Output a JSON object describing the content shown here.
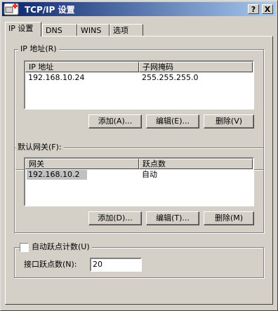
{
  "window": {
    "title": "TCP/IP 设置",
    "help_label": "?",
    "close_label": "X"
  },
  "tabs": [
    {
      "label": "IP 设置",
      "active": true
    },
    {
      "label": "DNS"
    },
    {
      "label": "WINS"
    },
    {
      "label": "选项"
    }
  ],
  "ip_group": {
    "label": "IP 地址(R)",
    "columns": [
      "IP 地址",
      "子网掩码"
    ],
    "rows": [
      [
        "192.168.10.24",
        "255.255.255.0"
      ]
    ],
    "buttons": {
      "add": "添加(A)...",
      "edit": "编辑(E)...",
      "delete": "删除(V)"
    }
  },
  "gateway_group": {
    "label": "默认网关(F):",
    "columns": [
      "网关",
      "跃点数"
    ],
    "rows": [
      [
        "192.168.10.2",
        "自动"
      ]
    ],
    "buttons": {
      "add": "添加(D)...",
      "edit": "编辑(T)...",
      "delete": "删除(M)"
    }
  },
  "metric_group": {
    "auto_metric_label": "自动跃点计数(U)",
    "auto_metric_checked": false,
    "interface_metric_label": "接口跃点数(N):",
    "interface_metric_value": "20"
  }
}
